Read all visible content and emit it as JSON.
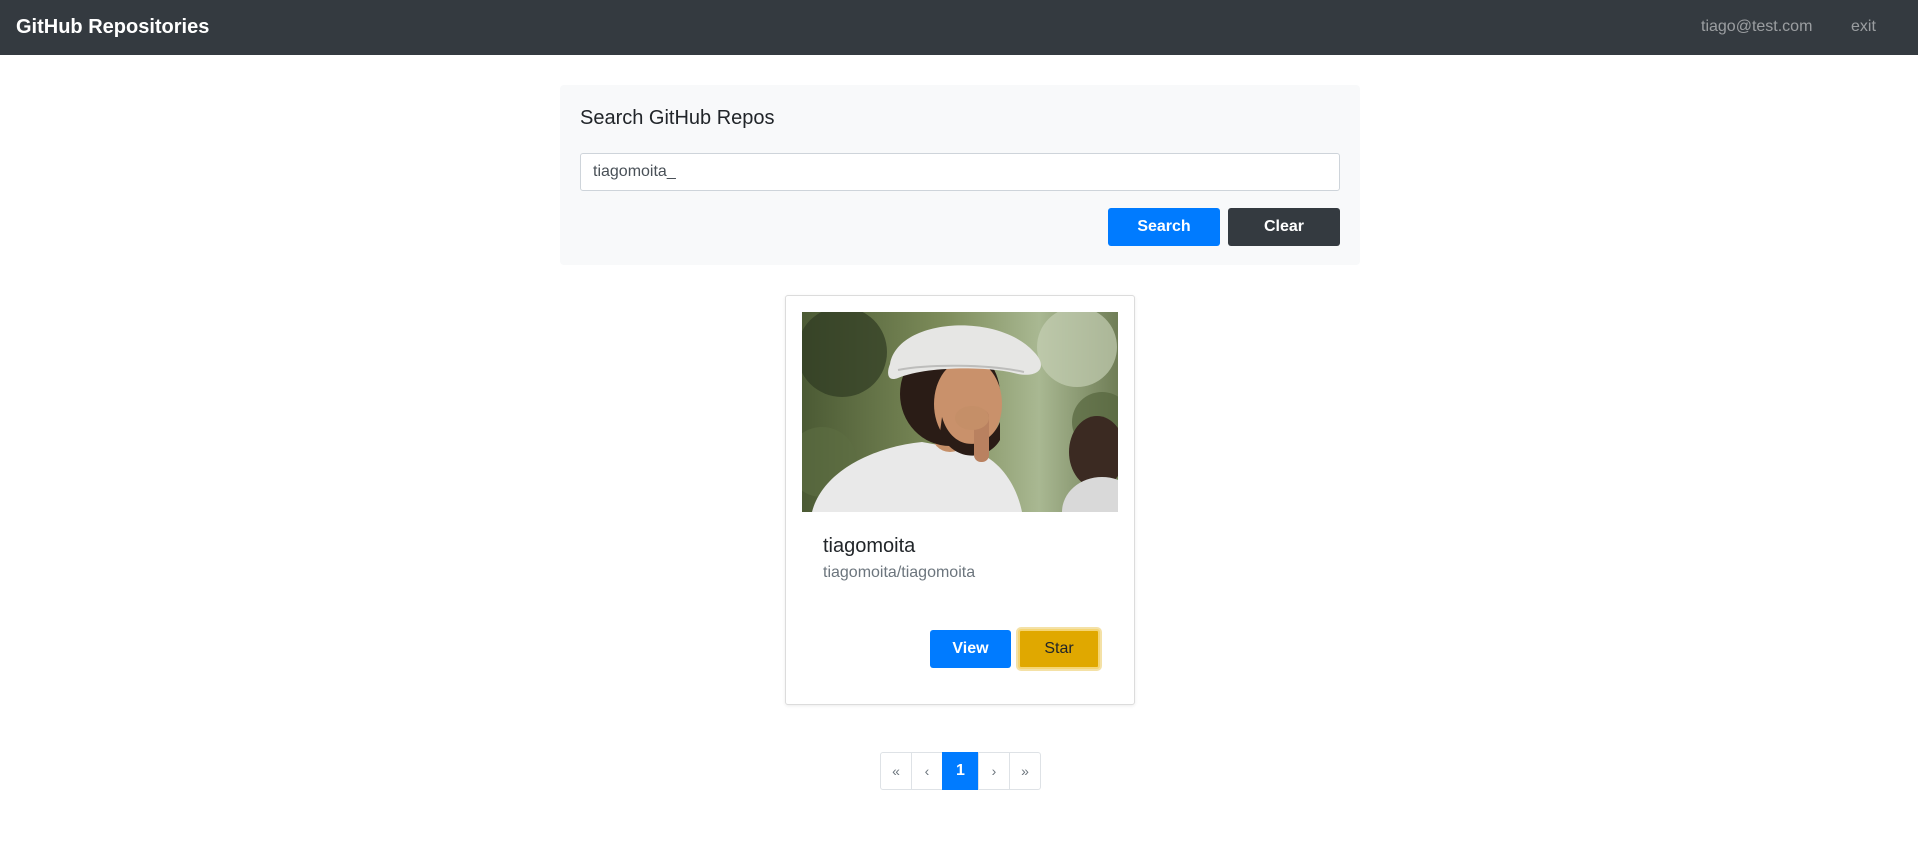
{
  "navbar": {
    "brand": "GitHub Repositories",
    "user_email": "tiago@test.com",
    "exit_label": "exit"
  },
  "search": {
    "title": "Search GitHub Repos",
    "value": "tiagomoita_",
    "search_label": "Search",
    "clear_label": "Clear"
  },
  "results": [
    {
      "name": "tiagomoita",
      "full_name": "tiagomoita/tiagomoita",
      "view_label": "View",
      "star_label": "Star"
    }
  ],
  "pagination": {
    "first": "«",
    "prev": "‹",
    "current": "1",
    "next": "›",
    "last": "»"
  },
  "colors": {
    "navbar": "#343a40",
    "primary": "#007bff",
    "dark": "#343a40",
    "warning": "#e0a800",
    "panel": "#f8f9fa"
  }
}
